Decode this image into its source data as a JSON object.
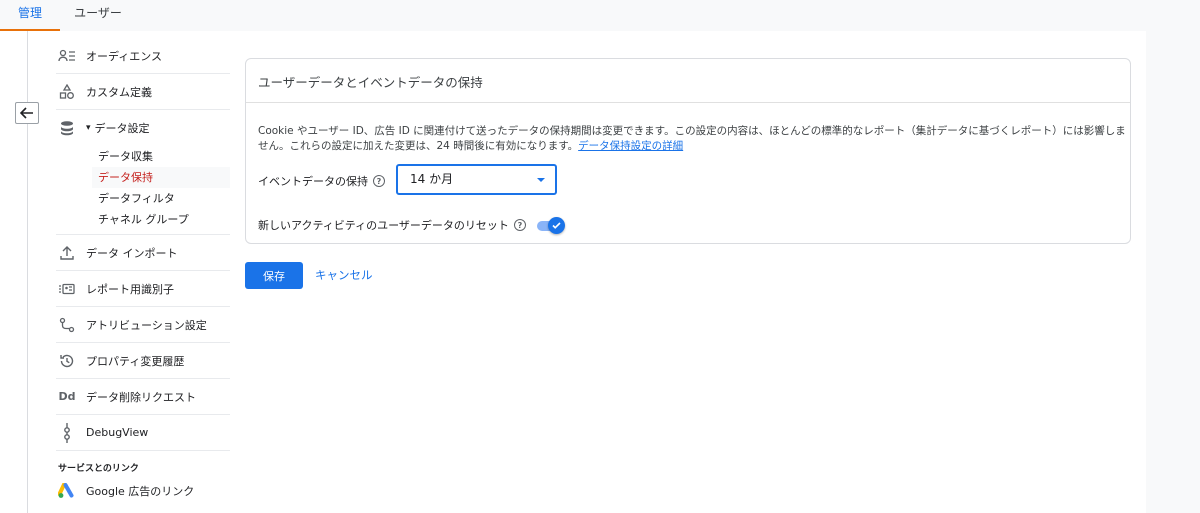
{
  "tabs": [
    {
      "label": "管理"
    },
    {
      "label": "ユーザー"
    }
  ],
  "sidebar": {
    "items": [
      {
        "label": "オーディエンス",
        "icon": "audience-icon"
      },
      {
        "label": "カスタム定義",
        "icon": "custom-definitions-icon"
      },
      {
        "label": "データ設定",
        "icon": "database-icon"
      },
      {
        "label": "データ インポート",
        "icon": "upload-icon"
      },
      {
        "label": "レポート用識別子",
        "icon": "identifier-icon"
      },
      {
        "label": "アトリビューション設定",
        "icon": "attribution-icon"
      },
      {
        "label": "プロパティ変更履歴",
        "icon": "history-icon"
      },
      {
        "label": "データ削除リクエスト",
        "icon": "dd-icon"
      },
      {
        "label": "DebugView",
        "icon": "debug-icon"
      }
    ],
    "expand_marker": "▾",
    "subitems": [
      {
        "label": "データ収集"
      },
      {
        "label": "データ保持"
      },
      {
        "label": "データフィルタ"
      },
      {
        "label": "チャネル グループ"
      }
    ],
    "section_label": "サービスとのリンク",
    "link_item": {
      "label": "Google 広告のリンク",
      "icon": "google-ads-icon"
    },
    "dd_text": "Dd"
  },
  "card": {
    "title": "ユーザーデータとイベントデータの保持",
    "description": "Cookie やユーザー ID、広告 ID に関連付けて送ったデータの保持期間は変更できます。この設定の内容は、ほとんどの標準的なレポート（集計データに基づくレポート）には影響しません。これらの設定に加えた変更は、24 時間後に有効になります。",
    "link_text": "データ保持設定の詳細",
    "event_retention_label": "イベントデータの保持",
    "event_retention_value": "14 か月",
    "reset_label": "新しいアクティビティのユーザーデータのリセット",
    "help_glyph": "?",
    "reset_enabled": true
  },
  "buttons": {
    "save": "保存",
    "cancel": "キャンセル"
  },
  "colors": {
    "accent": "#1a73e8",
    "active_sub": "#c5221f",
    "active_tab_underline": "#e8710a"
  }
}
